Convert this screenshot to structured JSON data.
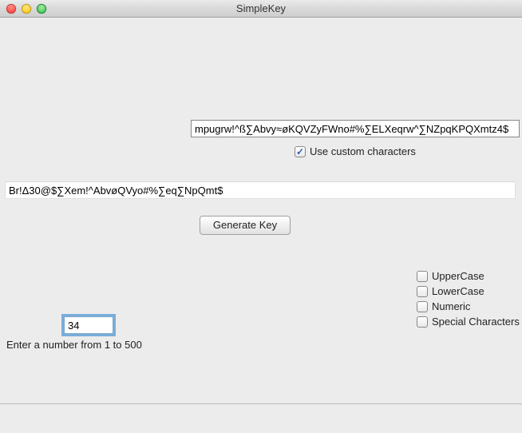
{
  "window": {
    "title": "SimpleKey"
  },
  "customChars": {
    "value": "mpugrw!^ß∑Abvy≈øKQVZyFWno#%∑ELXeqrw^∑NZpqKPQXmtz4$",
    "useCustomLabel": "Use custom characters",
    "useCustomChecked": true
  },
  "output": {
    "value": "Br!Δ30@$∑Xem!^AbvøQVyo#%∑eq∑NpQmt$"
  },
  "buttons": {
    "generate": "Generate Key"
  },
  "length": {
    "value": "34",
    "hint": "Enter a number from 1 to 500"
  },
  "options": {
    "uppercase": {
      "label": "UpperCase",
      "checked": false
    },
    "lowercase": {
      "label": "LowerCase",
      "checked": false
    },
    "numeric": {
      "label": "Numeric",
      "checked": false
    },
    "special": {
      "label": "Special Characters",
      "checked": false
    }
  }
}
